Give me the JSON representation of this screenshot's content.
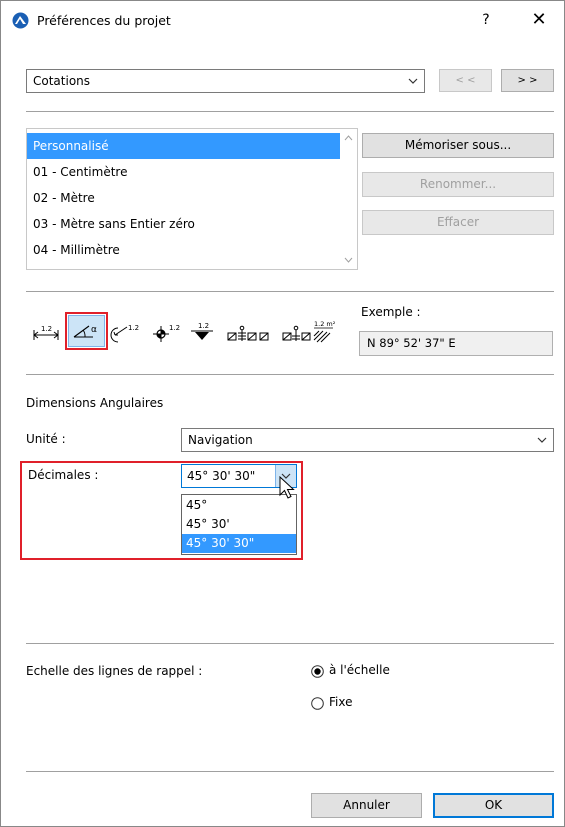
{
  "window": {
    "title": "Préférences du projet",
    "help_label": "?",
    "close_label": "✕"
  },
  "category_select": {
    "value": "Cotations"
  },
  "nav": {
    "prev_label": "< <",
    "next_label": "> >"
  },
  "presets": {
    "items": [
      {
        "label": "Personnalisé",
        "selected": true
      },
      {
        "label": "01 - Centimètre",
        "selected": false
      },
      {
        "label": "02 - Mètre",
        "selected": false
      },
      {
        "label": "03 - Mètre sans Entier zéro",
        "selected": false
      },
      {
        "label": "04 - Millimètre",
        "selected": false
      }
    ],
    "save_as_label": "Mémoriser sous...",
    "rename_label": "Renommer...",
    "delete_label": "Effacer"
  },
  "toolbar": {
    "icons": [
      "linear-dimension-icon",
      "angle-dimension-icon",
      "radial-dimension-icon",
      "level-dimension-icon",
      "elevation-dimension-icon",
      "door-window-dimension-icon",
      "sill-height-dimension-icon",
      "area-dimension-icon"
    ],
    "selected_icon": "angle-dimension-icon",
    "labels": {
      "linear": "1.2",
      "angle": "α",
      "radial": "1.2",
      "level": "1.2",
      "elevation": "1.2",
      "area": "1.2 m²"
    }
  },
  "example": {
    "label": "Exemple :",
    "value": "N 89° 52' 37\" E"
  },
  "angular": {
    "section_title": "Dimensions Angulaires",
    "unit_label": "Unité :",
    "unit_value": "Navigation",
    "decimals_label": "Décimales :",
    "decimals_value": "45° 30' 30\"",
    "decimals_options": [
      "45°",
      "45° 30'",
      "45° 30' 30\""
    ],
    "decimals_selected_index": 2
  },
  "extension_lines": {
    "label": "Echelle des lignes de rappel :",
    "option_scale": "à l'échelle",
    "option_fixed": "Fixe",
    "selected": "scale"
  },
  "footer": {
    "cancel_label": "Annuler",
    "ok_label": "OK"
  },
  "colors": {
    "selection_blue": "#3399ff",
    "highlight_red": "#e0202a",
    "app_icon_blue": "#1a5fb4"
  }
}
